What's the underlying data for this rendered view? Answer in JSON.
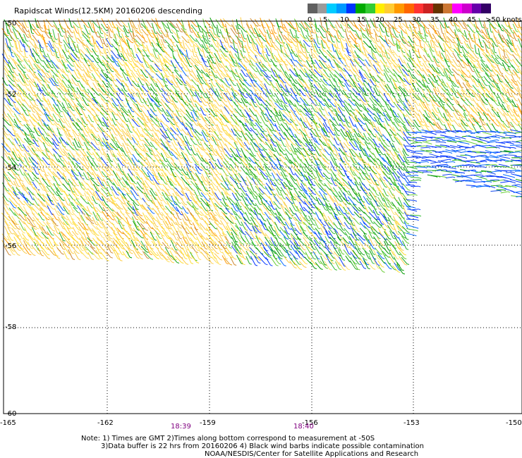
{
  "title": "Rapidscat Winds(12.5KM) 20160206 descending",
  "legend": {
    "colors": [
      "#606060",
      "#9a9a9a",
      "#00ccff",
      "#0099ff",
      "#0033ff",
      "#00aa00",
      "#33cc33",
      "#ffee00",
      "#ffcc33",
      "#ff9900",
      "#ff6600",
      "#ff3333",
      "#cc2222",
      "#663300",
      "#cc7733",
      "#ff00ff",
      "#cc00cc",
      "#6600aa",
      "#330066"
    ],
    "labels": [
      "0",
      "5",
      "10",
      "15",
      "20",
      "25",
      "30",
      "35",
      "40",
      "45",
      ">50 knots"
    ]
  },
  "axes": {
    "lon_labels": [
      "-165",
      "-162",
      "-159",
      "-156",
      "-153",
      "-150"
    ],
    "lat_labels": [
      "-50",
      "-52",
      "-54",
      "-56",
      "-58",
      "-60"
    ]
  },
  "times": [
    "18:39",
    "18:40"
  ],
  "notes": [
    "Note: 1) Times are GMT 2)Times along bottom correspond to measurement at -50S",
    "3)Data buffer is 22 hrs from 20160206 4) Black wind barbs indicate possible contamination",
    "NOAA/NESDIS/Center for Satellite Applications and Research"
  ]
}
